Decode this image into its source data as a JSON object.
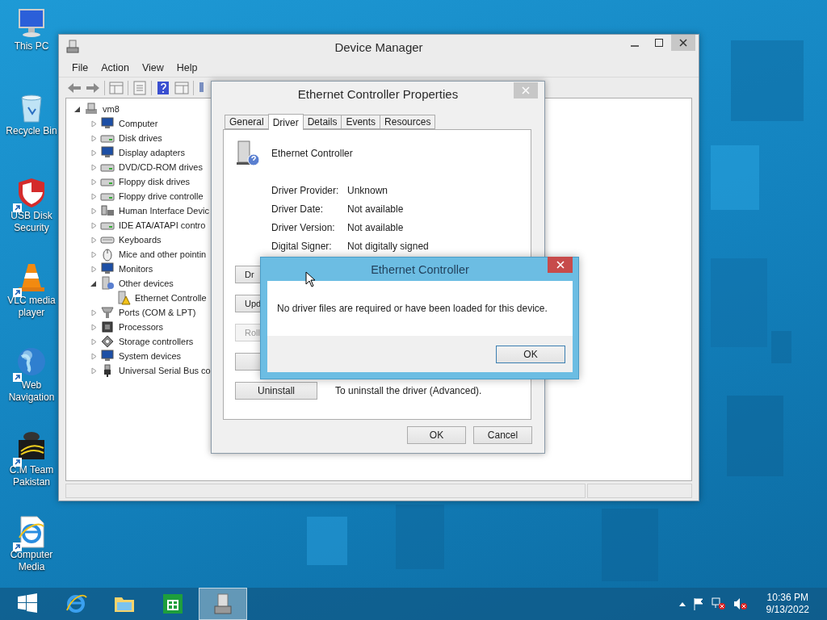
{
  "desktop_icons": [
    {
      "label": "This PC",
      "kind": "pc",
      "shortcut": false
    },
    {
      "label": "Recycle Bin",
      "kind": "bin",
      "shortcut": false
    },
    {
      "label": "USB Disk Security",
      "kind": "shield",
      "shortcut": true
    },
    {
      "label": "VLC media player",
      "kind": "cone",
      "shortcut": true
    },
    {
      "label": "Web Navigation",
      "kind": "globe",
      "shortcut": true
    },
    {
      "label": "C.M Team Pakistan",
      "kind": "cm",
      "shortcut": true
    },
    {
      "label": "Computer Media",
      "kind": "iedoc",
      "shortcut": true
    }
  ],
  "device_manager": {
    "title": "Device Manager",
    "menu": [
      "File",
      "Action",
      "View",
      "Help"
    ],
    "tree": {
      "label": "vm8",
      "kind": "host",
      "expanded": true,
      "children": [
        {
          "label": "Computer",
          "kind": "monitor",
          "expanded": false
        },
        {
          "label": "Disk drives",
          "kind": "drive",
          "expanded": false
        },
        {
          "label": "Display adapters",
          "kind": "monitor",
          "expanded": false
        },
        {
          "label": "DVD/CD-ROM drives",
          "kind": "drive",
          "expanded": false
        },
        {
          "label": "Floppy disk drives",
          "kind": "drive",
          "expanded": false
        },
        {
          "label": "Floppy drive controlle",
          "kind": "drive",
          "expanded": false
        },
        {
          "label": "Human Interface Devic",
          "kind": "hid",
          "expanded": false
        },
        {
          "label": "IDE ATA/ATAPI contro",
          "kind": "drive",
          "expanded": false
        },
        {
          "label": "Keyboards",
          "kind": "keyboard",
          "expanded": false
        },
        {
          "label": "Mice and other pointin",
          "kind": "mouse",
          "expanded": false
        },
        {
          "label": "Monitors",
          "kind": "monitor",
          "expanded": false
        },
        {
          "label": "Other devices",
          "kind": "unknown",
          "expanded": true,
          "children": [
            {
              "label": "Ethernet Controlle",
              "kind": "warning"
            }
          ]
        },
        {
          "label": "Ports (COM & LPT)",
          "kind": "port",
          "expanded": false
        },
        {
          "label": "Processors",
          "kind": "chip",
          "expanded": false
        },
        {
          "label": "Storage controllers",
          "kind": "storage",
          "expanded": false
        },
        {
          "label": "System devices",
          "kind": "monitor",
          "expanded": false
        },
        {
          "label": "Universal Serial Bus co",
          "kind": "usb",
          "expanded": false
        }
      ]
    }
  },
  "properties_dialog": {
    "title": "Ethernet Controller Properties",
    "tabs": [
      {
        "label": "General",
        "selected": false
      },
      {
        "label": "Driver",
        "selected": true
      },
      {
        "label": "Details",
        "selected": false
      },
      {
        "label": "Events",
        "selected": false
      },
      {
        "label": "Resources",
        "selected": false
      }
    ],
    "device_name": "Ethernet Controller",
    "fields": [
      {
        "label": "Driver Provider:",
        "value": "Unknown"
      },
      {
        "label": "Driver Date:",
        "value": "Not available"
      },
      {
        "label": "Driver Version:",
        "value": "Not available"
      },
      {
        "label": "Digital Signer:",
        "value": "Not digitally signed"
      }
    ],
    "actions": [
      {
        "label": "Dr",
        "disabled": false
      },
      {
        "label": "Upd",
        "disabled": false
      },
      {
        "label": "Roll",
        "disabled": true
      },
      {
        "disabled": false
      },
      {
        "label": "Uninstall",
        "disabled": false,
        "description": "To uninstall the driver (Advanced)."
      }
    ],
    "buttons": [
      "OK",
      "Cancel"
    ]
  },
  "message_box": {
    "title": "Ethernet Controller",
    "message": "No driver files are required or have been loaded for this device.",
    "button": "OK"
  },
  "taskbar": {
    "apps": [
      {
        "kind": "start",
        "selected": false
      },
      {
        "kind": "browser",
        "selected": false
      },
      {
        "kind": "explorer",
        "selected": false
      },
      {
        "kind": "store",
        "selected": false
      },
      {
        "kind": "devmgr",
        "selected": true
      }
    ],
    "time": "10:36 PM",
    "date": "9/13/2022"
  }
}
